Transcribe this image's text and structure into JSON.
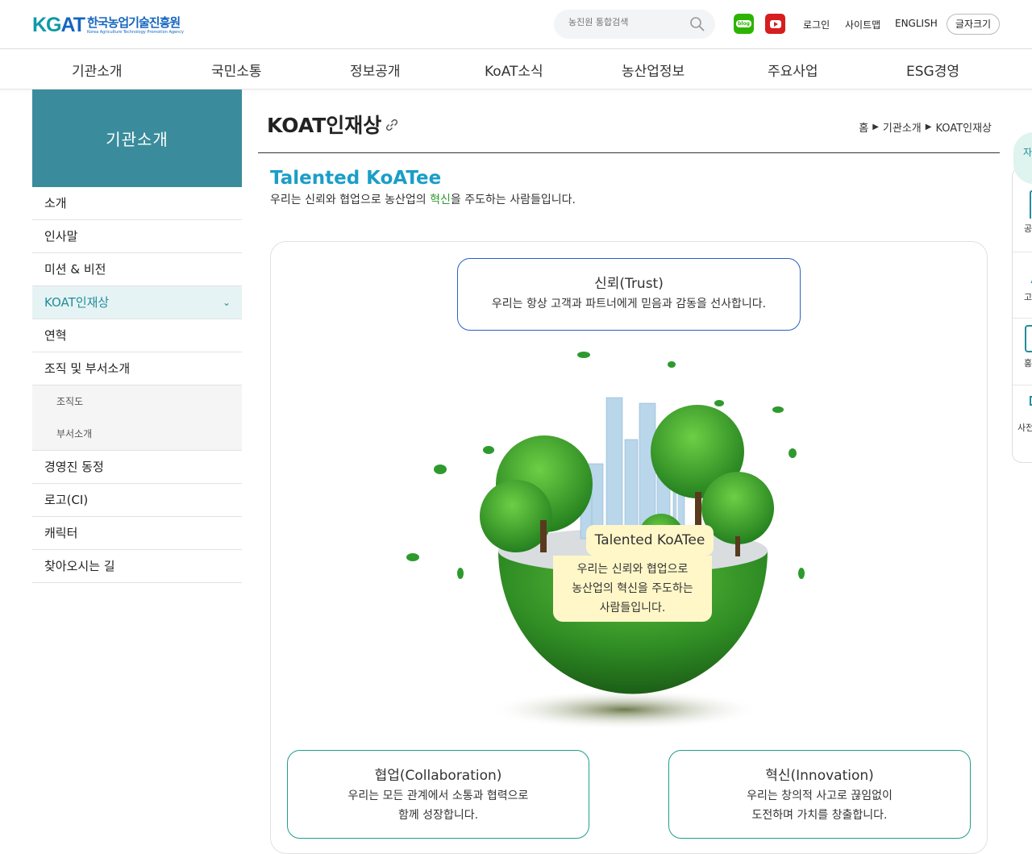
{
  "header": {
    "logo_mark_a": "KG",
    "logo_mark_b": "AT",
    "logo_ko": "한국농업기술진흥원",
    "logo_en": "Korea Agriculture Technology Promotion Agency",
    "search_placeholder": "농진원 통합검색",
    "blog_label": "blog",
    "login": "로그인",
    "sitemap": "사이트맵",
    "english": "ENGLISH",
    "font_size": "글자크기"
  },
  "gnb": [
    "기관소개",
    "국민소통",
    "정보공개",
    "KoAT소식",
    "농산업정보",
    "주요사업",
    "ESG경영"
  ],
  "sidebar": {
    "title": "기관소개",
    "items": [
      "소개",
      "인사말",
      "미션 & 비전",
      "KOAT인재상",
      "연혁",
      "조직 및 부서소개"
    ],
    "sub_items": [
      "조직도",
      "부서소개"
    ],
    "items_after": [
      "경영진 동정",
      "로고(CI)",
      "캐릭터",
      "찾아오시는 길"
    ]
  },
  "page": {
    "title": "KOAT인재상",
    "breadcrumb": [
      "홈",
      "기관소개",
      "KOAT인재상"
    ],
    "heading": "Talented KoATee",
    "desc_before": "우리는 신뢰와 협업으로 농산업의 ",
    "desc_highlight": "혁신",
    "desc_after": "을 주도하는 사람들입니다."
  },
  "values": {
    "trust": {
      "title": "신뢰(Trust)",
      "desc": "우리는 항상 고객과 파트너에게 믿음과 감동을 선사합니다."
    },
    "collab": {
      "title": "협업(Collaboration)",
      "desc1": "우리는 모든 관계에서 소통과 협력으로",
      "desc2": "함께 성장합니다."
    },
    "innov": {
      "title": "혁신(Innovation)",
      "desc1": "우리는 창의적 사고로 끊임없이",
      "desc2": "도전하며 가치를 창출합니다."
    }
  },
  "center": {
    "tag": "Talented KoATee",
    "line1": "우리는 신뢰와 협업으로",
    "line2": "농산업의 혁신을 주도하는",
    "line3": "사람들입니다."
  },
  "quickbar": {
    "top": "자",
    "labels": [
      "공",
      "고",
      "홍",
      "사전"
    ]
  }
}
